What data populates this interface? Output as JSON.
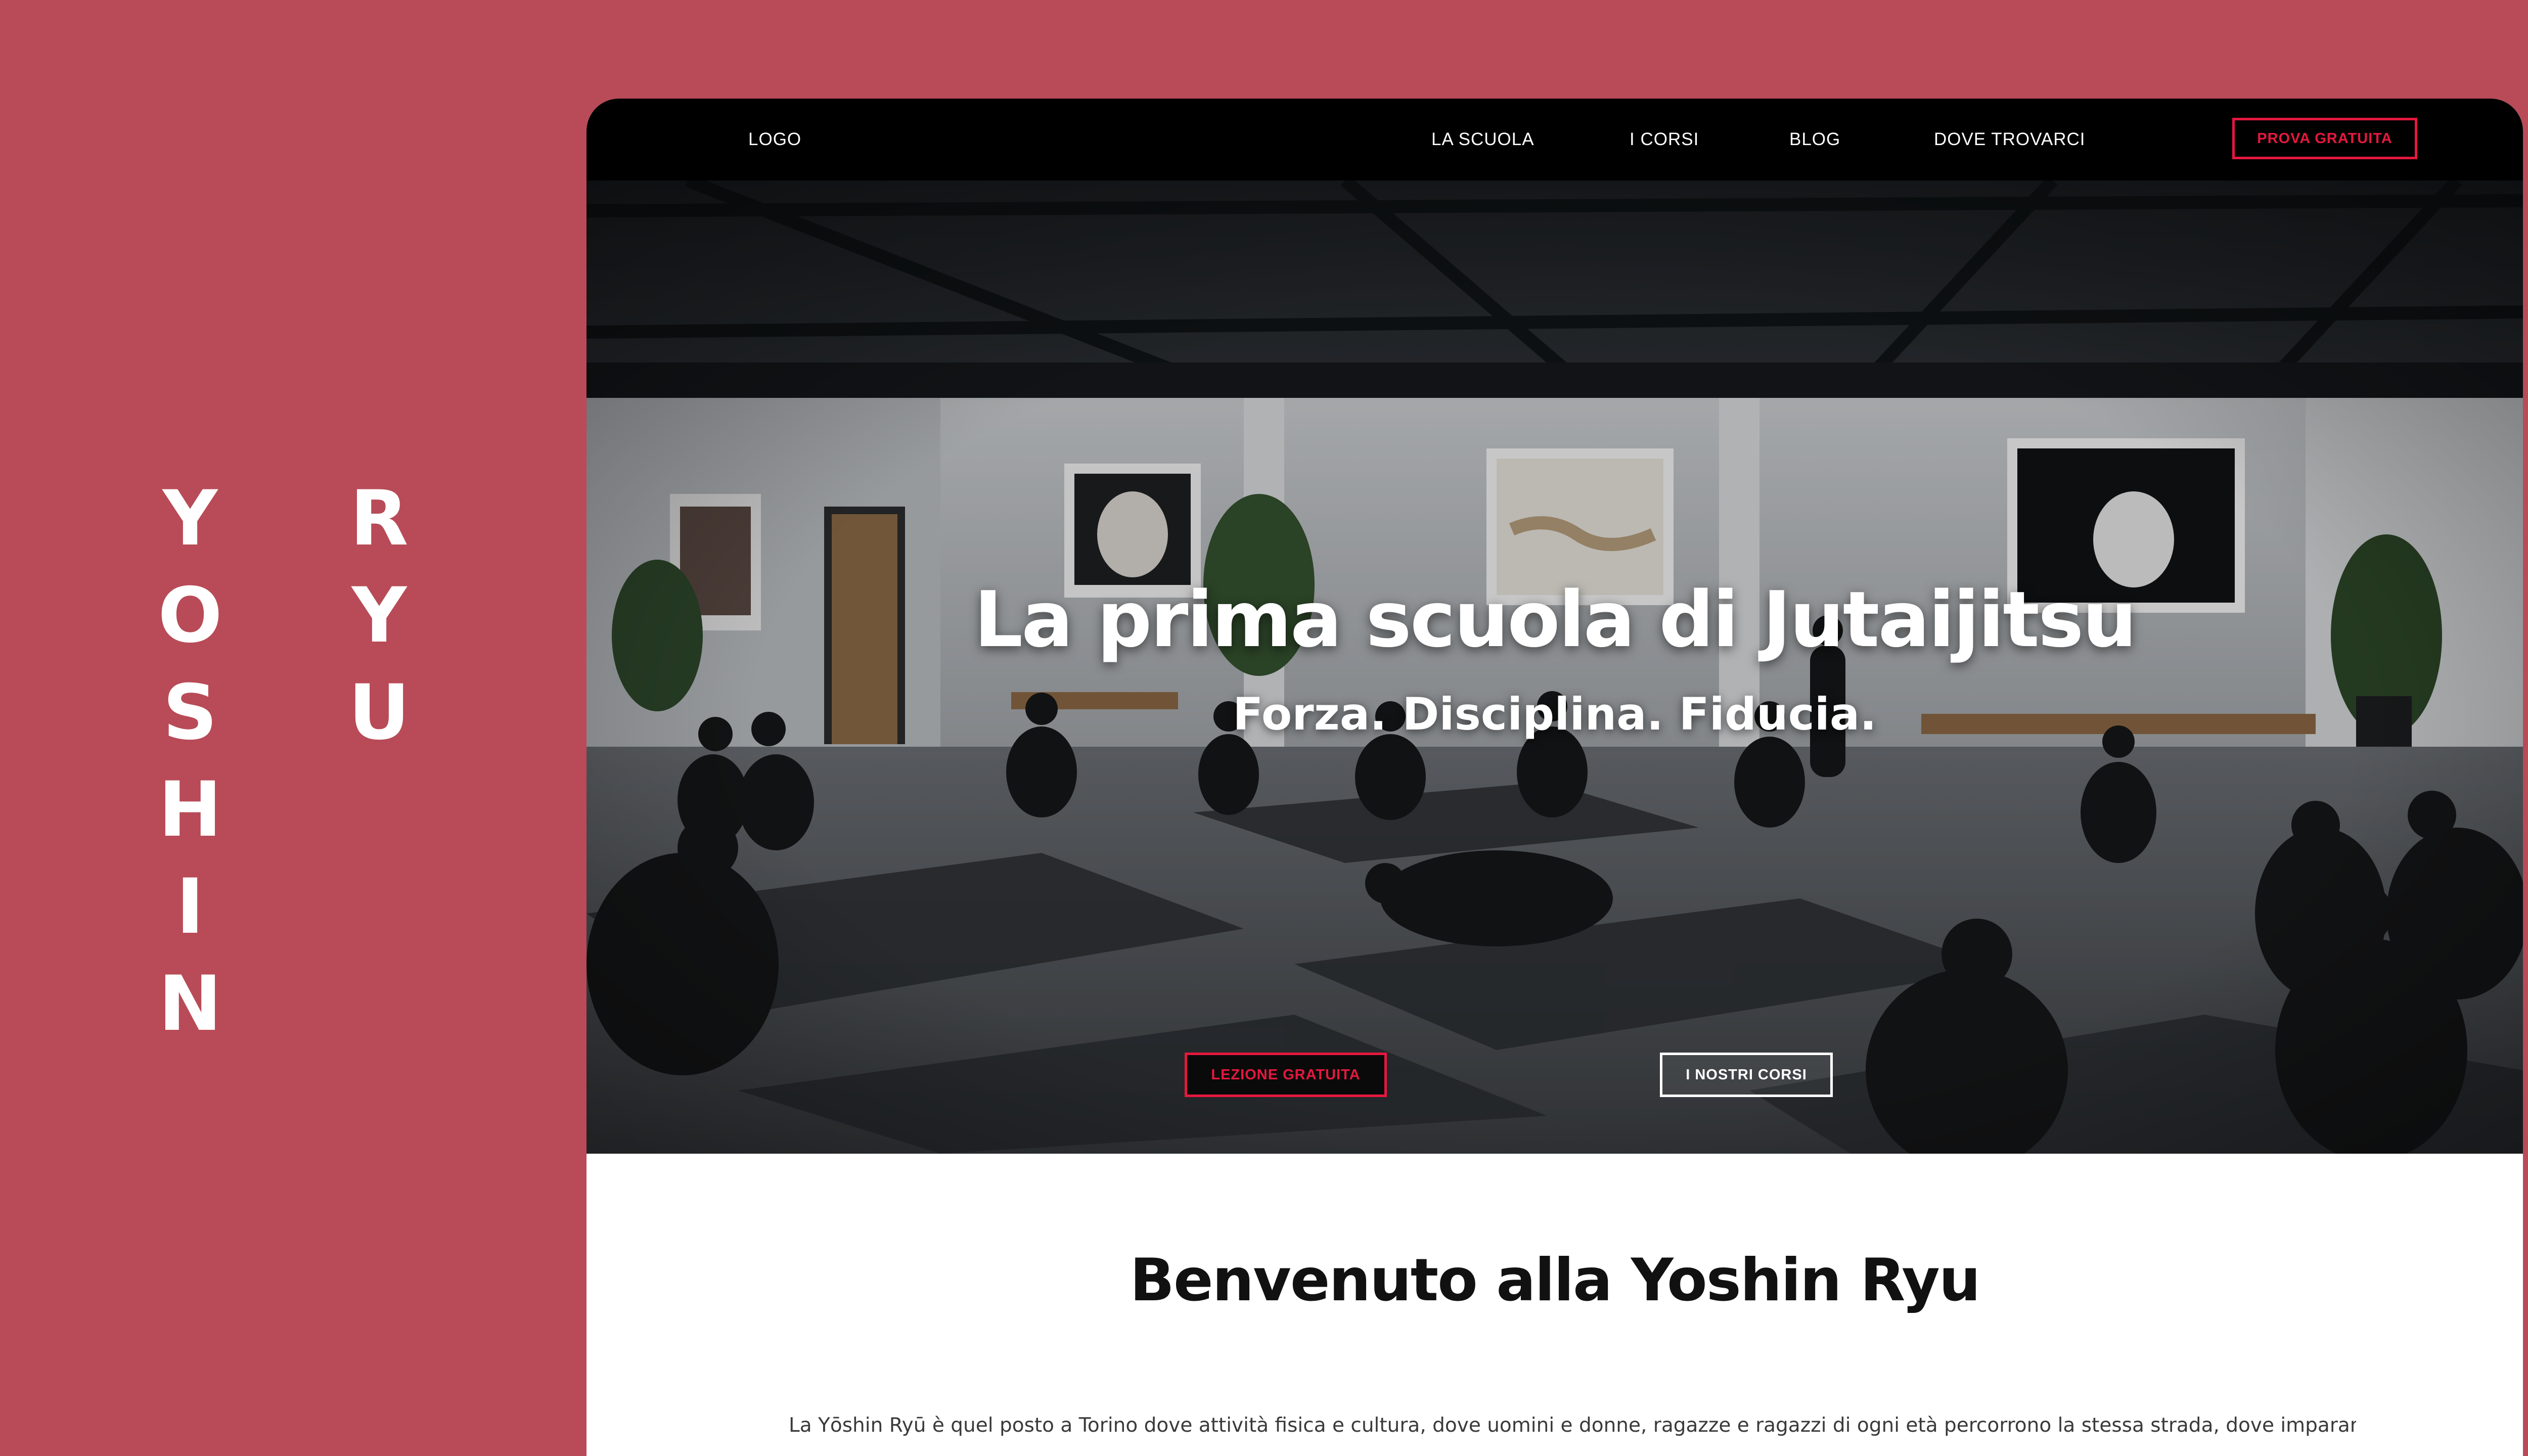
{
  "brand": {
    "left_letters": [
      "Y",
      "O",
      "S",
      "H",
      "I",
      "N"
    ],
    "right_letters": [
      "R",
      "Y",
      "U"
    ]
  },
  "nav": {
    "logo": "LOGO",
    "links": [
      "LA SCUOLA",
      "I CORSI",
      "BLOG",
      "DOVE TROVARCI"
    ],
    "cta": "PROVA GRATUITA"
  },
  "hero": {
    "title": "La prima scuola di Jutaijitsu",
    "subtitle": "Forza. Disciplina. Fiducia.",
    "primary_button": "LEZIONE GRATUITA",
    "secondary_button": "I NOSTRI CORSI"
  },
  "welcome": {
    "title": "Benvenuto alla Yoshin Ryu",
    "text": "La Yōshin Ryū è quel posto a Torino dove attività fisica e cultura, dove uomini e donne, ragazze e ragazzi di ogni età percorrono la stessa strada, dove imparare a"
  },
  "colors": {
    "background": "#b84b57",
    "accent": "#e5183e",
    "nav_bg": "#000000"
  }
}
